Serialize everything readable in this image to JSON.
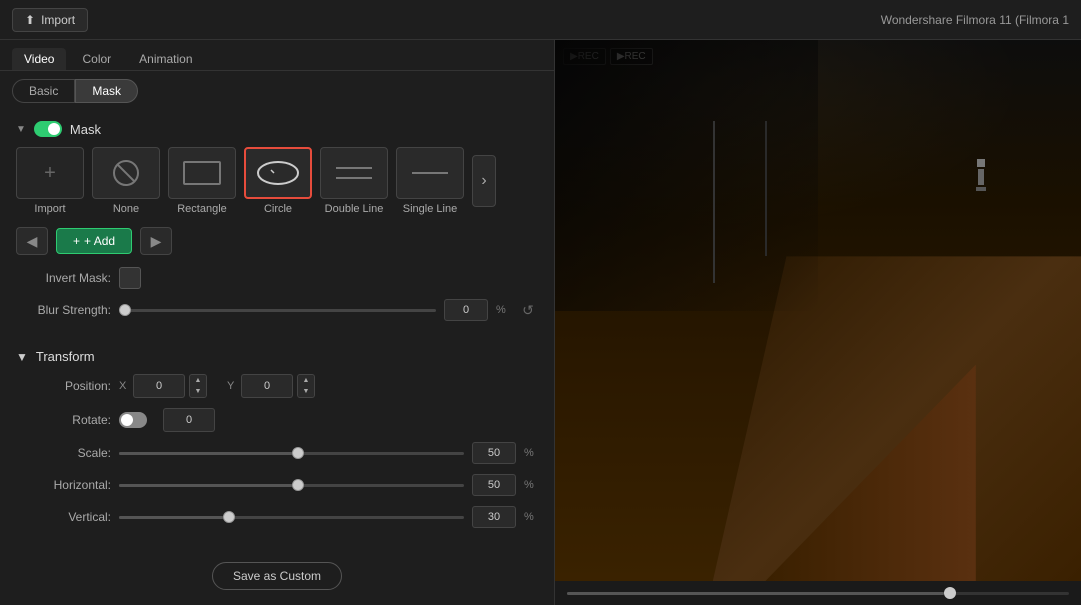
{
  "app": {
    "title": "Wondershare Filmora 11 (Filmora 1",
    "import_label": "Import"
  },
  "tabs": {
    "main": [
      "Video",
      "Color",
      "Animation"
    ],
    "active_main": "Video",
    "sub": [
      "Basic",
      "Mask"
    ],
    "active_sub": "Mask"
  },
  "mask_section": {
    "label": "Mask",
    "toggle_on": true,
    "items": [
      {
        "id": "import",
        "label": "Import",
        "icon": "plus"
      },
      {
        "id": "none",
        "label": "None",
        "icon": "slash-circle"
      },
      {
        "id": "rectangle",
        "label": "Rectangle",
        "icon": "rectangle"
      },
      {
        "id": "circle",
        "label": "Circle",
        "icon": "ellipse",
        "selected": true
      },
      {
        "id": "double-line",
        "label": "Double Line",
        "icon": "double-line"
      },
      {
        "id": "single-line",
        "label": "Single Line",
        "icon": "single-line"
      }
    ]
  },
  "add_controls": {
    "prev_label": "◀",
    "add_label": "+ Add",
    "next_label": "▶"
  },
  "invert_mask": {
    "label": "Invert Mask:",
    "value": false
  },
  "blur_strength": {
    "label": "Blur Strength:",
    "value": 0,
    "unit": "%",
    "min": 0,
    "max": 100,
    "percent": 0
  },
  "transform": {
    "section_label": "Transform",
    "position": {
      "label": "Position:",
      "x_label": "X",
      "x_value": "0",
      "y_label": "Y",
      "y_value": "0"
    },
    "rotate": {
      "label": "Rotate:",
      "value": "0"
    },
    "scale": {
      "label": "Scale:",
      "value": "50",
      "unit": "%",
      "percent": 50
    },
    "horizontal": {
      "label": "Horizontal:",
      "value": "50",
      "unit": "%",
      "percent": 50
    },
    "vertical": {
      "label": "Vertical:",
      "value": "30",
      "unit": "%",
      "percent": 30
    }
  },
  "save_custom": {
    "label": "Save as Custom"
  },
  "preview": {
    "rec_labels": [
      "▶REC",
      "▶REC"
    ]
  }
}
